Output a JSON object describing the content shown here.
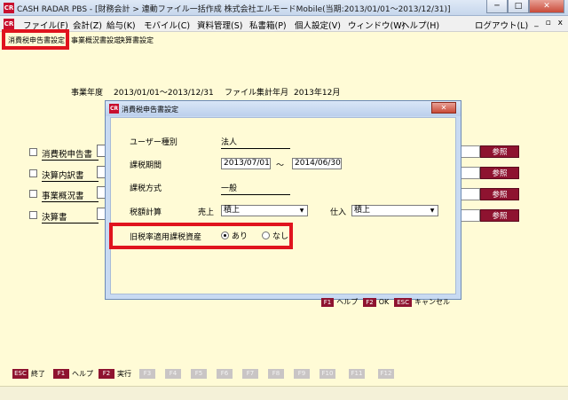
{
  "window": {
    "title": "CASH RADAR PBS - [財務会計 > 連動ファイル一括作成 株式会社エルモードMobile(当期:2013/01/01～2013/12/31)]",
    "app_icon": "CR",
    "min_label": "─",
    "max_label": "□",
    "close_label": "✕"
  },
  "menu": {
    "items": [
      "ファイル(F)",
      "会計(Z)",
      "給与(K)",
      "モバイル(C)",
      "資料管理(S)",
      "私書箱(P)",
      "個人設定(V)",
      "ウィンドウ(W)",
      "ヘルプ(H)",
      "ログアウト(L)"
    ],
    "mdi_min": "_",
    "mdi_restore": "▫",
    "mdi_close": "x"
  },
  "tabs": [
    "消費税申告書設定",
    "事業概況書設定",
    "決算書設定"
  ],
  "main": {
    "year_label": "事業年度",
    "year_value": "2013/01/01～2013/12/31",
    "file_label": "ファイル集計年月",
    "file_value": "2013年12月",
    "rows": [
      {
        "label": "消費税申告書",
        "button": "参照"
      },
      {
        "label": "決算内訳書",
        "button": "参照"
      },
      {
        "label": "事業概況書",
        "button": "参照"
      },
      {
        "label": "決算書",
        "button": "参照"
      }
    ]
  },
  "dialog": {
    "title": "消費税申告書設定",
    "user_type_label": "ユーザー種別",
    "user_type_value": "法人",
    "period_label": "課税期間",
    "period_from": "2013/07/01",
    "period_sep": "～",
    "period_to": "2014/06/30",
    "method_label": "課税方式",
    "method_value": "一般",
    "calc_label": "税額計算",
    "sales_label": "売上",
    "sales_value": "積上",
    "purchase_label": "仕入",
    "purchase_value": "積上",
    "old_rate_label": "旧税率適用課税資産",
    "radio_yes": "あり",
    "radio_no": "なし",
    "radio_selected": "yes",
    "footer": [
      {
        "key": "F1",
        "label": "ヘルプ"
      },
      {
        "key": "F2",
        "label": "OK"
      },
      {
        "key": "ESC",
        "label": "キャンセル"
      }
    ]
  },
  "fkeys": [
    {
      "key": "ESC",
      "label": "終了",
      "enabled": true
    },
    {
      "key": "F1",
      "label": "ヘルプ",
      "enabled": true
    },
    {
      "key": "F2",
      "label": "実行",
      "enabled": true
    },
    {
      "key": "F3",
      "label": "",
      "enabled": false
    },
    {
      "key": "F4",
      "label": "",
      "enabled": false
    },
    {
      "key": "F5",
      "label": "",
      "enabled": false
    },
    {
      "key": "F6",
      "label": "",
      "enabled": false
    },
    {
      "key": "F7",
      "label": "",
      "enabled": false
    },
    {
      "key": "F8",
      "label": "",
      "enabled": false
    },
    {
      "key": "F9",
      "label": "",
      "enabled": false
    },
    {
      "key": "F10",
      "label": "",
      "enabled": false
    },
    {
      "key": "F11",
      "label": "",
      "enabled": false
    },
    {
      "key": "F12",
      "label": "",
      "enabled": false
    }
  ],
  "colors": {
    "background": "#fffbd6",
    "accent": "#8e1330",
    "highlight": "#e0141e"
  }
}
